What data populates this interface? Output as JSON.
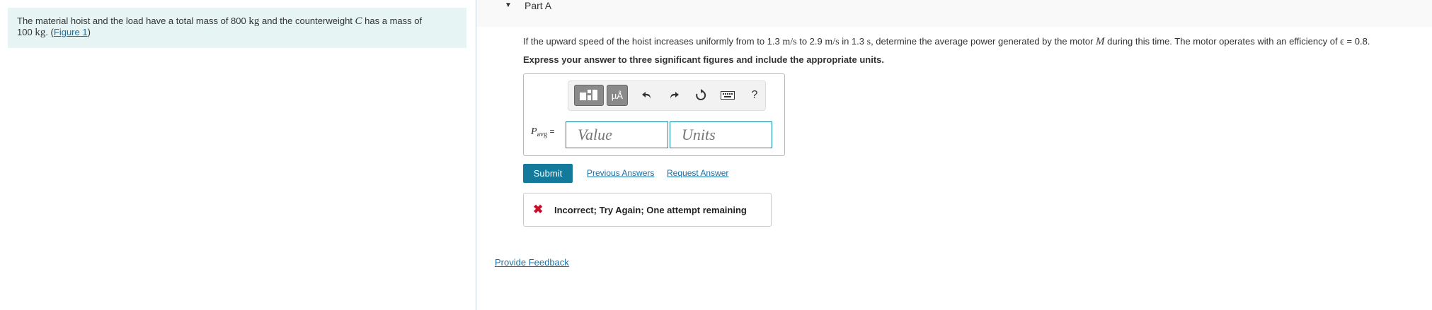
{
  "intro": {
    "text_a": "The material hoist and the load have a total mass of 800 ",
    "unit_kg": "kg",
    "text_b": " and the counterweight ",
    "var_c": "C",
    "text_c": " has a mass of",
    "text_d": "100 ",
    "text_e": ". ",
    "figure_link": "Figure 1"
  },
  "part": {
    "title": "Part A"
  },
  "question": {
    "t1": "If the upward speed of the hoist increases uniformly from to 1.3 ",
    "u1": "m/s",
    "t2": " to 2.9 ",
    "t3": " in 1.3 ",
    "u2": "s",
    "t4": ", determine the average power generated by the motor ",
    "var_m": "M",
    "t5": " during this time. The motor operates with an efficiency of ϵ = 0.8."
  },
  "instruction": "Express your answer to three significant figures and include the appropriate units.",
  "answer": {
    "var_main": "P",
    "var_sub": "avg",
    "equals": "=",
    "value_placeholder": "Value",
    "units_placeholder": "Units",
    "toolbar": {
      "units_label": "µÅ",
      "help_label": "?"
    }
  },
  "actions": {
    "submit": "Submit",
    "previous_answers": "Previous Answers",
    "request_answer": "Request Answer"
  },
  "feedback": {
    "icon": "✖",
    "message": "Incorrect; Try Again; One attempt remaining"
  },
  "provide_feedback": "Provide Feedback"
}
